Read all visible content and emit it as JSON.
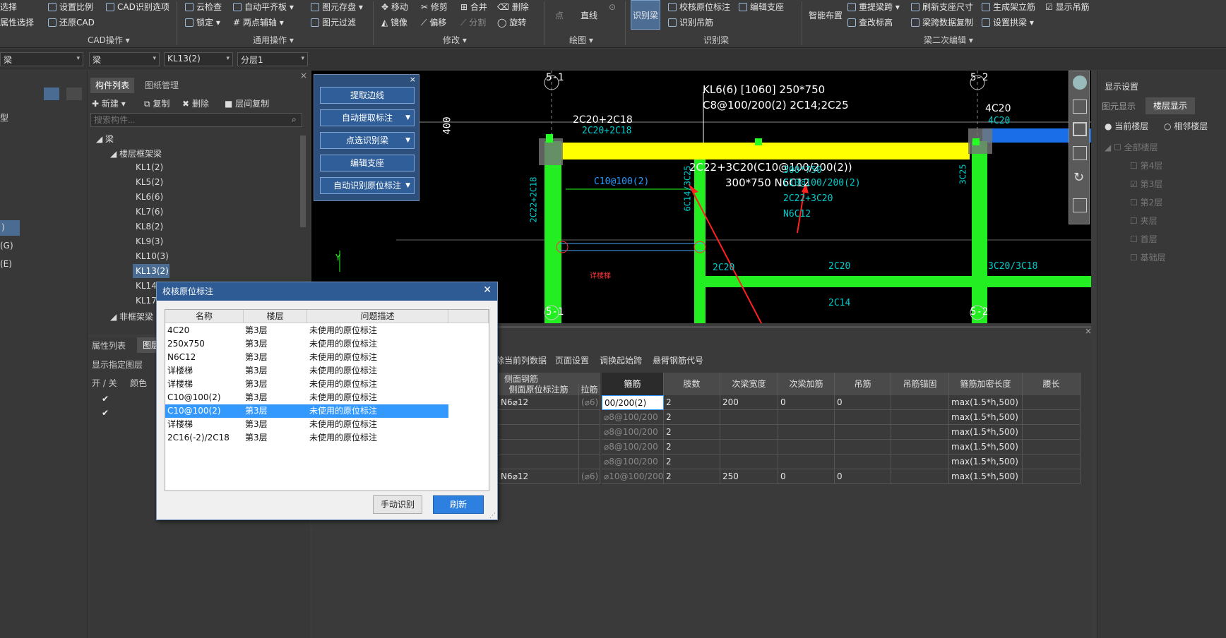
{
  "ribbon": {
    "r1": [
      "选择",
      "设置比例",
      "CAD识别选项",
      "云检查",
      "自动平齐板",
      "图元存盘",
      "移动",
      "修剪",
      "合并",
      "删除",
      "点",
      "直线",
      "识别梁",
      "校核原位标注",
      "编辑支座",
      "智能布置",
      "重提梁跨",
      "刷新支座尺寸",
      "生成架立筋",
      "显示吊筋"
    ],
    "r2": [
      "属性选择",
      "还原CAD",
      "锁定",
      "两点辅轴",
      "图元过滤",
      "镜像",
      "偏移",
      "分割",
      "旋转",
      "识别吊筋",
      "查改标高",
      "梁跨数据复制",
      "设置拱梁"
    ],
    "groups": [
      "CAD操作",
      "通用操作",
      "修改",
      "绘图",
      "识别梁",
      "梁二次编辑"
    ]
  },
  "selectors": [
    "梁",
    "梁",
    "KL13(2)",
    "分层1"
  ],
  "left": {
    "type_label": "型",
    "item_g": "(G)",
    "item_e": "(E)",
    "item_l": ")"
  },
  "component_panel": {
    "tabs": [
      "构件列表",
      "图纸管理"
    ],
    "actions": [
      "新建",
      "复制",
      "删除",
      "层间复制"
    ],
    "search_placeholder": "搜索构件...",
    "tree_root": "梁",
    "group1": "楼层框架梁",
    "items": [
      "KL1(2)",
      "KL5(2)",
      "KL6(6)",
      "KL7(6)",
      "KL8(2)",
      "KL9(3)",
      "KL10(3)",
      "KL13(2)",
      "KL14(",
      "KL17"
    ],
    "group2": "非框架梁"
  },
  "props_panel": {
    "tabs": [
      "属性列表",
      "图层"
    ],
    "show_label": "显示指定图层",
    "cols": [
      "开 / 关",
      "颜色"
    ]
  },
  "float_panel": {
    "buttons": [
      "提取边线",
      "自动提取标注",
      "点选识别梁",
      "编辑支座",
      "自动识别原位标注"
    ]
  },
  "canvas": {
    "axis1": "5-1",
    "axis2": "5-2",
    "axis1b": "5-1",
    "axis2b": "5-2",
    "label1": "KL6(6) [1060] 250*750",
    "label2": "C8@100/200(2) 2C14;2C25",
    "top_left_bar": "2C20+2C18",
    "top_left_bar2": "2C20+2C18",
    "top_right": "4C20",
    "top_right2": "4C20",
    "mid_label": "2C22+3C20(C10@100/200(2))",
    "mid_label2": "300*750 N6C12",
    "stirrup": "C10@100(2)",
    "dim": "400",
    "side_cols": [
      "2C22+2C18",
      "6C14/3C25",
      "3C25"
    ],
    "cyan_extra": [
      "2C22+3C20",
      "N6C12",
      "C10@100/200(2)",
      "300*750"
    ],
    "bottom": [
      "2C20",
      "2C20",
      "2C14",
      "3C20/3C18"
    ],
    "detail": "详楼梯",
    "y_axis": "Y"
  },
  "grid": {
    "toolbar": [
      "除当前列数据",
      "页面设置",
      "调换起始跨",
      "悬臂钢筋代号"
    ],
    "group_head": "侧面钢筋",
    "headers": [
      "侧面原位标注筋",
      "拉筋",
      "箍筋",
      "肢数",
      "次梁宽度",
      "次梁加筋",
      "吊筋",
      "吊筋锚固",
      "箍筋加密长度",
      "腰长"
    ],
    "rows": [
      [
        "N6⌀12",
        "(⌀6)",
        "00/200(2)",
        "2",
        "200",
        "0",
        "0",
        "",
        "max(1.5*h,500)",
        ""
      ],
      [
        "",
        "",
        "⌀8@100/200",
        "2",
        "",
        "",
        "",
        "",
        "max(1.5*h,500)",
        ""
      ],
      [
        "",
        "",
        "⌀8@100/200",
        "2",
        "",
        "",
        "",
        "",
        "max(1.5*h,500)",
        ""
      ],
      [
        "",
        "",
        "⌀8@100/200",
        "2",
        "",
        "",
        "",
        "",
        "max(1.5*h,500)",
        ""
      ],
      [
        "",
        "",
        "⌀8@100/200",
        "2",
        "",
        "",
        "",
        "",
        "max(1.5*h,500)",
        ""
      ],
      [
        "N6⌀12",
        "(⌀6)",
        "⌀10@100/200",
        "2",
        "250",
        "0",
        "0",
        "",
        "max(1.5*h,500)",
        ""
      ]
    ]
  },
  "right_panel": {
    "title": "显示设置",
    "tabs": [
      "图元显示",
      "楼层显示"
    ],
    "radios": [
      "当前楼层",
      "相邻楼层"
    ],
    "floors": [
      "全部楼层",
      "第4层",
      "第3层",
      "第2层",
      "夹层",
      "首层",
      "基础层"
    ]
  },
  "dialog": {
    "title": "校核原位标注",
    "headers": [
      "名称",
      "楼层",
      "问题描述"
    ],
    "rows": [
      [
        "4C20",
        "第3层",
        "未使用的原位标注"
      ],
      [
        "250x750",
        "第3层",
        "未使用的原位标注"
      ],
      [
        "N6C12",
        "第3层",
        "未使用的原位标注"
      ],
      [
        "详楼梯",
        "第3层",
        "未使用的原位标注"
      ],
      [
        "详楼梯",
        "第3层",
        "未使用的原位标注"
      ],
      [
        "C10@100(2)",
        "第3层",
        "未使用的原位标注"
      ],
      [
        "C10@100(2)",
        "第3层",
        "未使用的原位标注"
      ],
      [
        "详楼梯",
        "第3层",
        "未使用的原位标注"
      ],
      [
        "2C16(-2)/2C18",
        "第3层",
        "未使用的原位标注"
      ]
    ],
    "selected_row": 6,
    "btn_manual": "手动识别",
    "btn_refresh": "刷新"
  },
  "colors": {
    "accent": "#3399ff",
    "yellow": "#ffff00",
    "green": "#22ee22",
    "cyan": "#00c8c8",
    "red_arrow": "#ff2020"
  }
}
